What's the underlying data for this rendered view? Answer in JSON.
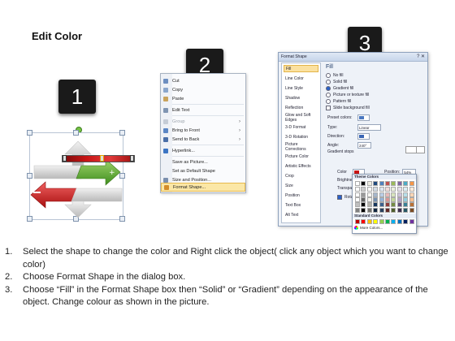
{
  "title": "Edit Color",
  "badges": [
    "1",
    "2",
    "3"
  ],
  "context_menu": {
    "items": [
      {
        "label": "Cut",
        "icon": "scissors-icon"
      },
      {
        "label": "Copy",
        "icon": "copy-icon"
      },
      {
        "label": "Paste",
        "icon": "paste-icon"
      },
      {
        "label": "Edit Text",
        "icon": "edit-text-icon"
      },
      {
        "label": "Group",
        "icon": "group-icon",
        "disabled": true,
        "submenu": true
      },
      {
        "label": "Bring to Front",
        "icon": "bring-front-icon",
        "submenu": true
      },
      {
        "label": "Send to Back",
        "icon": "send-back-icon",
        "submenu": true
      },
      {
        "label": "Hyperlink...",
        "icon": "hyperlink-icon"
      },
      {
        "label": "Save as Picture...",
        "icon": ""
      },
      {
        "label": "Set as Default Shape",
        "icon": ""
      },
      {
        "label": "Size and Position...",
        "icon": "size-position-icon"
      },
      {
        "label": "Format Shape...",
        "icon": "format-shape-icon",
        "highlighted": true
      }
    ]
  },
  "dialog": {
    "title": "Format Shape",
    "close": "?  ✕",
    "categories": [
      "Fill",
      "Line Color",
      "Line Style",
      "Shadow",
      "Reflection",
      "Glow and Soft Edges",
      "3-D Format",
      "3-D Rotation",
      "Picture Corrections",
      "Picture Color",
      "Artistic Effects",
      "Crop",
      "Size",
      "Position",
      "Text Box",
      "Alt Text"
    ],
    "selected_category": "Fill",
    "panel_title": "Fill",
    "fill_options": [
      {
        "label": "No fill",
        "type": "radio",
        "checked": false
      },
      {
        "label": "Solid fill",
        "type": "radio",
        "checked": false
      },
      {
        "label": "Gradient fill",
        "type": "radio",
        "checked": true
      },
      {
        "label": "Picture or texture fill",
        "type": "radio",
        "checked": false
      },
      {
        "label": "Pattern fill",
        "type": "radio",
        "checked": false
      },
      {
        "label": "Slide background fill",
        "type": "checkbox",
        "checked": false
      }
    ],
    "preset_label": "Preset colors:",
    "type_label": "Type:",
    "type_value": "Linear",
    "direction_label": "Direction:",
    "angle_label": "Angle:",
    "angle_value": "240°",
    "gradient_stops_label": "Gradient stops",
    "color_label": "Color",
    "position_label": "Position:",
    "position_value": "54%",
    "brightness_label": "Brightness:",
    "transparency_label": "Transparency:",
    "rotate_label": "Rotate"
  },
  "palette": {
    "theme_header": "Theme Colors",
    "standard_header": "Standard Colors",
    "more_colors": "More Colors...",
    "theme_colors": [
      "#ffffff",
      "#000000",
      "#eeece1",
      "#1f497d",
      "#4f81bd",
      "#c0504d",
      "#9bbb59",
      "#8064a2",
      "#4bacc6",
      "#f79646"
    ],
    "standard_colors": [
      "#c00000",
      "#ff0000",
      "#ffc000",
      "#ffff00",
      "#92d050",
      "#00b050",
      "#00b0f0",
      "#0070c0",
      "#002060",
      "#7030a0"
    ]
  },
  "steps": [
    {
      "num": "1.",
      "text": "Select the shape to change the color and Right click the object( click any object which you want to change color)"
    },
    {
      "num": "2.",
      "text": "Choose Format Shape in the dialog box."
    },
    {
      "num": "3.",
      "text": "Choose “Fill” in the Format Shape box then “Solid” or “Gradient” depending on the appearance of the object. Change colour as shown in the picture."
    }
  ]
}
